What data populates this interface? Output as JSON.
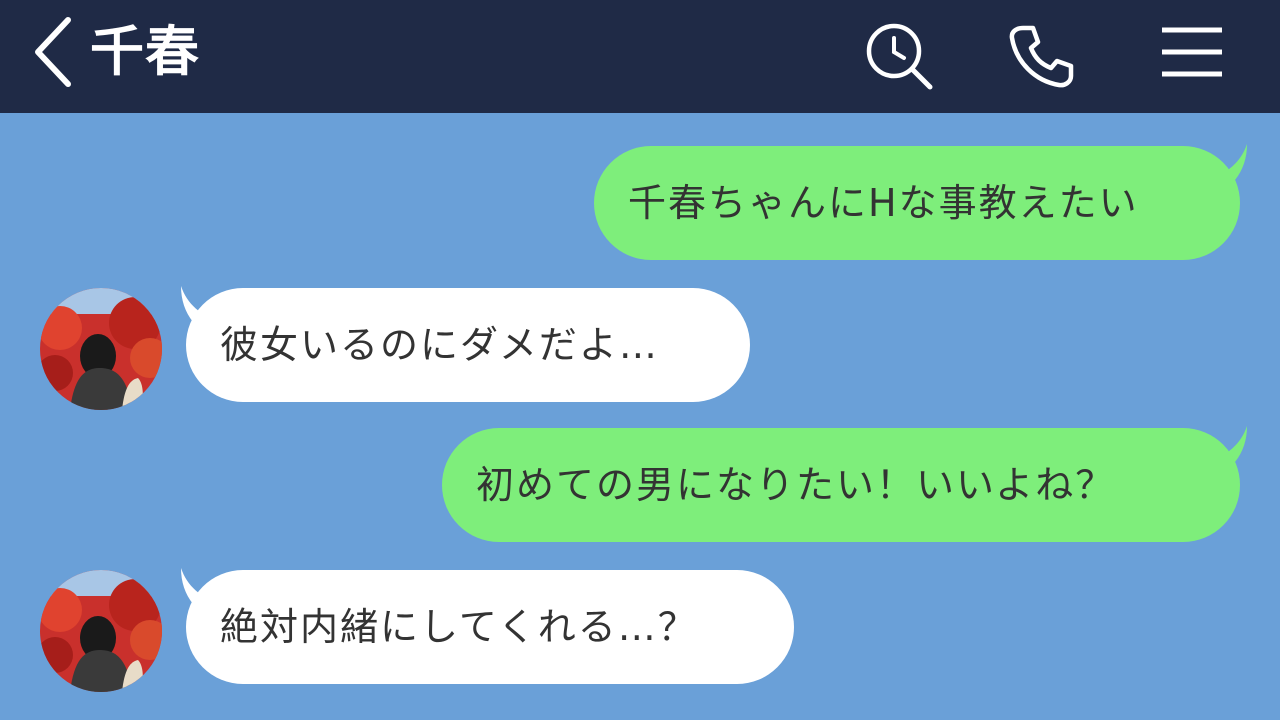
{
  "header": {
    "contact_name": "千春",
    "icons": [
      "back-chevron-icon",
      "search-clock-icon",
      "phone-icon",
      "menu-icon"
    ]
  },
  "messages": [
    {
      "direction": "sent",
      "text": "千春ちゃんにHな事教えたい"
    },
    {
      "direction": "received",
      "text": "彼女いるのにダメだよ…"
    },
    {
      "direction": "sent",
      "text": "初めての男になりたい！いいよね？"
    },
    {
      "direction": "received",
      "text": "絶対内緒にしてくれる…？"
    }
  ],
  "colors": {
    "header_bg": "#1f2a46",
    "chat_bg": "#6aa0d8",
    "sent_bubble": "#7eee7b",
    "received_bubble": "#ffffff",
    "text": "#333333"
  }
}
